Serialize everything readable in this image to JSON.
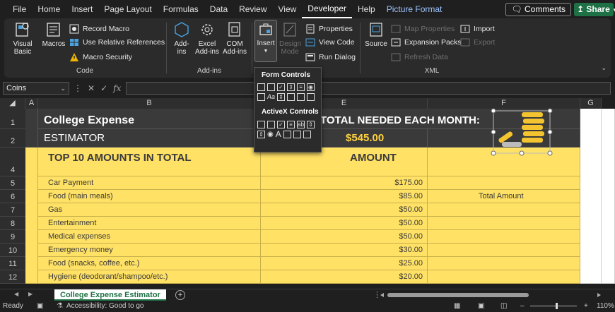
{
  "menu": {
    "tabs": [
      "File",
      "Home",
      "Insert",
      "Page Layout",
      "Formulas",
      "Data",
      "Review",
      "View",
      "Developer",
      "Help",
      "Picture Format"
    ],
    "active_tab": "Developer",
    "comments_label": "Comments",
    "share_label": "Share"
  },
  "ribbon": {
    "code": {
      "visual_basic": "Visual Basic",
      "macros": "Macros",
      "record_macro": "Record Macro",
      "use_relative": "Use Relative References",
      "macro_security": "Macro Security",
      "label": "Code"
    },
    "addins": {
      "addins": "Add-ins",
      "excel_addins": "Excel Add-ins",
      "com_addins": "COM Add-ins",
      "label": "Add-ins"
    },
    "controls": {
      "insert": "Insert",
      "design_mode": "Design Mode",
      "properties": "Properties",
      "view_code": "View Code",
      "run_dialog": "Run Dialog"
    },
    "xml": {
      "source": "Source",
      "map_properties": "Map Properties",
      "expansion_packs": "Expansion Packs",
      "refresh_data": "Refresh Data",
      "import": "Import",
      "export": "Export",
      "label": "XML"
    }
  },
  "formula_bar": {
    "name_box": "Coins",
    "fx": "fx"
  },
  "dropdown": {
    "form_controls_title": "Form Controls",
    "activex_title": "ActiveX Controls"
  },
  "columns": [
    "A",
    "B",
    "E",
    "F",
    "G"
  ],
  "rows": [
    "1",
    "2",
    "4",
    "5",
    "6",
    "7",
    "8",
    "9",
    "10",
    "11",
    "12"
  ],
  "sheet": {
    "title1": "College Expense",
    "title2": "ESTIMATOR",
    "total_needed_label": "TOTAL NEEDED EACH MONTH:",
    "total_value": "$545.00",
    "list_header": "TOP 10 AMOUNTS IN TOTAL",
    "amount_header": "AMOUNT",
    "chart_label": "Total Amount",
    "items": [
      {
        "name": "Car Payment",
        "amount": "$175.00"
      },
      {
        "name": "Food (main meals)",
        "amount": "$85.00"
      },
      {
        "name": "Gas",
        "amount": "$50.00"
      },
      {
        "name": "Entertainment",
        "amount": "$50.00"
      },
      {
        "name": "Medical expenses",
        "amount": "$50.00"
      },
      {
        "name": "Emergency money",
        "amount": "$30.00"
      },
      {
        "name": "Food (snacks, coffee, etc.)",
        "amount": "$25.00"
      },
      {
        "name": "Hygiene (deodorant/shampoo/etc.)",
        "amount": "$20.00"
      }
    ]
  },
  "tabs_bar": {
    "sheet_name": "College Expense Estimator"
  },
  "status": {
    "ready": "Ready",
    "accessibility": "Accessibility: Good to go",
    "zoom": "110%"
  }
}
